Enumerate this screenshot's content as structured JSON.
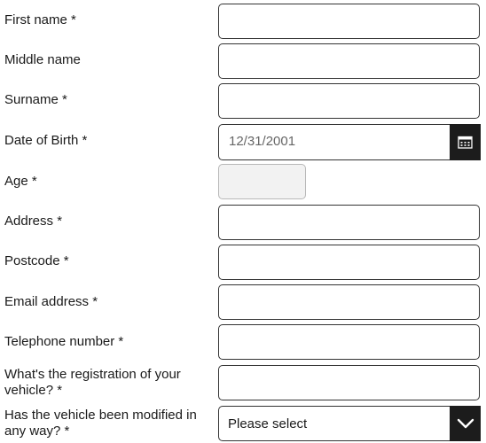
{
  "form": {
    "first_name": {
      "label": "First name *",
      "value": ""
    },
    "middle_name": {
      "label": "Middle name",
      "value": ""
    },
    "surname": {
      "label": "Surname *",
      "value": ""
    },
    "dob": {
      "label": "Date of Birth *",
      "placeholder": "12/31/2001",
      "icon": "calendar-icon"
    },
    "age": {
      "label": "Age *",
      "value": ""
    },
    "address": {
      "label": "Address *",
      "value": ""
    },
    "postcode": {
      "label": "Postcode *",
      "value": ""
    },
    "email": {
      "label": "Email address *",
      "value": ""
    },
    "telephone": {
      "label": "Telephone number *",
      "value": ""
    },
    "registration": {
      "label": "What's the registration of your vehicle? *",
      "value": ""
    },
    "modified": {
      "label": "Has the vehicle  been modified in any way? *",
      "selected": "Please select",
      "icon": "chevron-down-icon"
    }
  },
  "colors": {
    "button_bg": "#1c1c1c",
    "border": "#333333",
    "disabled_bg": "#f2f2f2"
  }
}
